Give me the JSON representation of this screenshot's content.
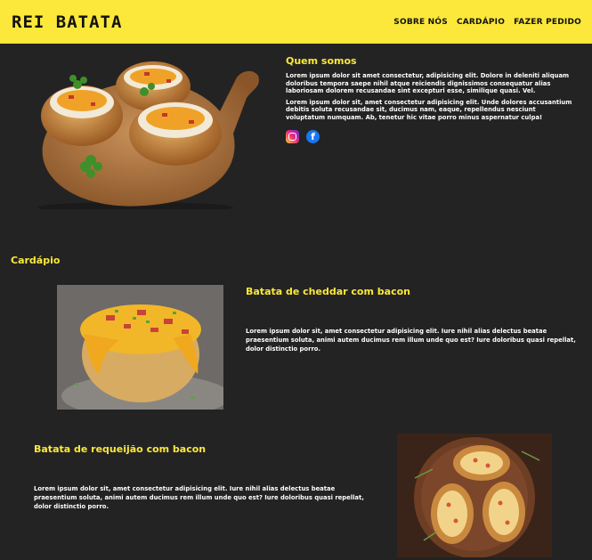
{
  "header": {
    "logo": "REI BATATA",
    "nav": [
      "SOBRE NÓS",
      "CARDÁPIO",
      "FAZER PEDIDO"
    ]
  },
  "about": {
    "title": "Quem somos",
    "paragraphs": [
      "Lorem ipsum dolor sit amet consectetur, adipisicing elit. Dolore in deleniti aliquam doloribus tempora saepe nihil atque reiciendis dignissimos consequatur alias laboriosam dolorem recusandae sint excepturi esse, similique quasi. Vel.",
      "Lorem ipsum dolor sit, amet consectetur adipisicing elit. Unde dolores accusantium debitis soluta recusandae sit, ducimus nam, eaque, repellendus nesciunt voluptatum numquam. Ab, tenetur hic vitae porro minus aspernatur culpa!"
    ]
  },
  "menu": {
    "title": "Cardápio",
    "items": [
      {
        "name": "Batata de cheddar com bacon",
        "description": "Lorem ipsum dolor sit, amet consectetur adipisicing elit. Iure nihil alias delectus beatae praesentium soluta, animi autem ducimus rem illum unde quo est? Iure doloribus quasi repellat, dolor distinctio porro."
      },
      {
        "name": "Batata de requeijão com bacon",
        "description": "Lorem ipsum dolor sit, amet consectetur adipisicing elit. Iure nihil alias delectus beatae praesentium soluta, animi autem ducimus rem illum unde quo est? Iure doloribus quasi repellat, dolor distinctio porro."
      }
    ]
  },
  "icons": {
    "instagram": "instagram-icon",
    "facebook": "facebook-icon"
  },
  "colors": {
    "accent": "#fce83a",
    "background": "#232323",
    "text": "#ffffff"
  }
}
